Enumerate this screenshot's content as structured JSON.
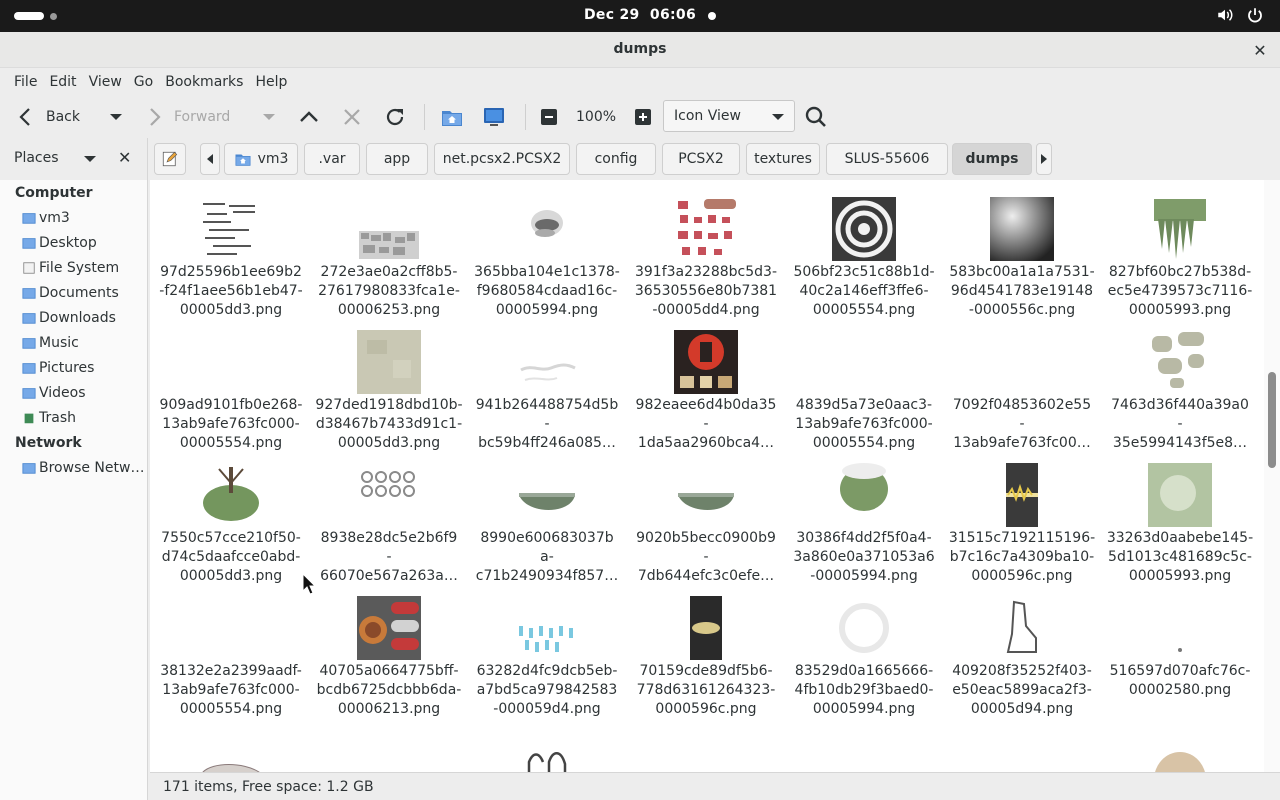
{
  "system": {
    "date": "Dec 29",
    "time": "06:06"
  },
  "window": {
    "title": "dumps"
  },
  "menus": [
    "File",
    "Edit",
    "View",
    "Go",
    "Bookmarks",
    "Help"
  ],
  "toolbar": {
    "back_label": "Back",
    "forward_label": "Forward",
    "zoom": "100%",
    "view_mode": "Icon View"
  },
  "places": {
    "label": "Places"
  },
  "path": [
    "vm3",
    ".var",
    "app",
    "net.pcsx2.PCSX2",
    "config",
    "PCSX2",
    "textures",
    "SLUS-55606",
    "dumps"
  ],
  "sidebar": {
    "computer_label": "Computer",
    "computer_items": [
      "vm3",
      "Desktop",
      "File System",
      "Documents",
      "Downloads",
      "Music",
      "Pictures",
      "Videos",
      "Trash"
    ],
    "network_label": "Network",
    "network_items": [
      "Browse Netw…"
    ]
  },
  "files": [
    {
      "name": [
        "97d25596b1ee69b2",
        "-f24f1aee56b1eb47-",
        "00005dd3.png"
      ],
      "thumb": "text"
    },
    {
      "name": [
        "272e3ae0a2cff8b5-",
        "27617980833fca1e-",
        "00006253.png"
      ],
      "thumb": "mosaic"
    },
    {
      "name": [
        "365bba104e1c1378-",
        "f9680584cdaad16c-",
        "00005994.png"
      ],
      "thumb": "eye"
    },
    {
      "name": [
        "391f3a23288bc5d3-",
        "36530556e80b7381",
        "-00005dd4.png"
      ],
      "thumb": "glyphs"
    },
    {
      "name": [
        "506bf23c51c88b1d-",
        "40c2a146eff3ffe6-",
        "00005554.png"
      ],
      "thumb": "spiral"
    },
    {
      "name": [
        "583bc00a1a1a7531-",
        "96d4541783e19148",
        "-0000556c.png"
      ],
      "thumb": "dark"
    },
    {
      "name": [
        "827bf60bc27b538d-",
        "ec5e4739573c7116-",
        "00005993.png"
      ],
      "thumb": "grass"
    },
    {
      "name": [
        "909ad9101fb0e268-",
        "13ab9afe763fc000-",
        "00005554.png"
      ],
      "thumb": "blank"
    },
    {
      "name": [
        "927ded1918dbd10b-",
        "d38467b7433d91c1-",
        "00005dd3.png"
      ],
      "thumb": "stone"
    },
    {
      "name": [
        "941b264488754d5b",
        "-",
        "bc59b4ff246a085…"
      ],
      "thumb": "wisp"
    },
    {
      "name": [
        "982eaee6d4b0da35",
        "-",
        "1da5aa2960bca4…"
      ],
      "thumb": "redsign"
    },
    {
      "name": [
        "4839d5a73e0aac3-",
        "13ab9afe763fc000-",
        "00005554.png"
      ],
      "thumb": "blank"
    },
    {
      "name": [
        "7092f04853602e55",
        "-",
        "13ab9afe763fc00…"
      ],
      "thumb": "blank"
    },
    {
      "name": [
        "7463d36f440a39a0",
        "-",
        "35e5994143f5e8…"
      ],
      "thumb": "patches"
    },
    {
      "name": [
        "7550c57cce210f50-",
        "d74c5daafcce0abd-",
        "00005dd3.png"
      ],
      "thumb": "tree"
    },
    {
      "name": [
        "8938e28dc5e2b6f9",
        "-",
        "66070e567a263a…"
      ],
      "thumb": "numbers"
    },
    {
      "name": [
        "8990e600683037b",
        "a-",
        "c71b2490934f857…"
      ],
      "thumb": "bowl"
    },
    {
      "name": [
        "9020b5becc0900b9",
        "-",
        "7db644efc3c0efe…"
      ],
      "thumb": "bowl"
    },
    {
      "name": [
        "30386f4dd2f5f0a4-",
        "3a860e0a371053a6",
        "-00005994.png"
      ],
      "thumb": "bush"
    },
    {
      "name": [
        "31515c7192115196-",
        "b7c16c7a4309ba10-",
        "0000596c.png"
      ],
      "thumb": "glow"
    },
    {
      "name": [
        "33263d0aabebe145-",
        "5d1013c481689c5c-",
        "00005993.png"
      ],
      "thumb": "pale"
    },
    {
      "name": [
        "38132e2a2399aadf-",
        "13ab9afe763fc000-",
        "00005554.png"
      ],
      "thumb": "blank"
    },
    {
      "name": [
        "40705a0664775bff-",
        "bcdb6725dcbbb6da-",
        "00006213.png"
      ],
      "thumb": "atlas"
    },
    {
      "name": [
        "63282d4fc9dcb5eb-",
        "a7bd5ca979842583",
        "-000059d4.png"
      ],
      "thumb": "drops"
    },
    {
      "name": [
        "70159cde89df5b6-",
        "778d63161264323-",
        "0000596c.png"
      ],
      "thumb": "glow2"
    },
    {
      "name": [
        "83529d0a1665666-",
        "4fb10db29f3baed0-",
        "00005994.png"
      ],
      "thumb": "faint"
    },
    {
      "name": [
        "409208f35252f403-",
        "e50eac5899aca2f3-",
        "00005d94.png"
      ],
      "thumb": "sketch"
    },
    {
      "name": [
        "516597d070afc76c-",
        "00002580.png"
      ],
      "thumb": "dot"
    }
  ],
  "status": {
    "text": "171 items, Free space: 1.2 GB"
  }
}
